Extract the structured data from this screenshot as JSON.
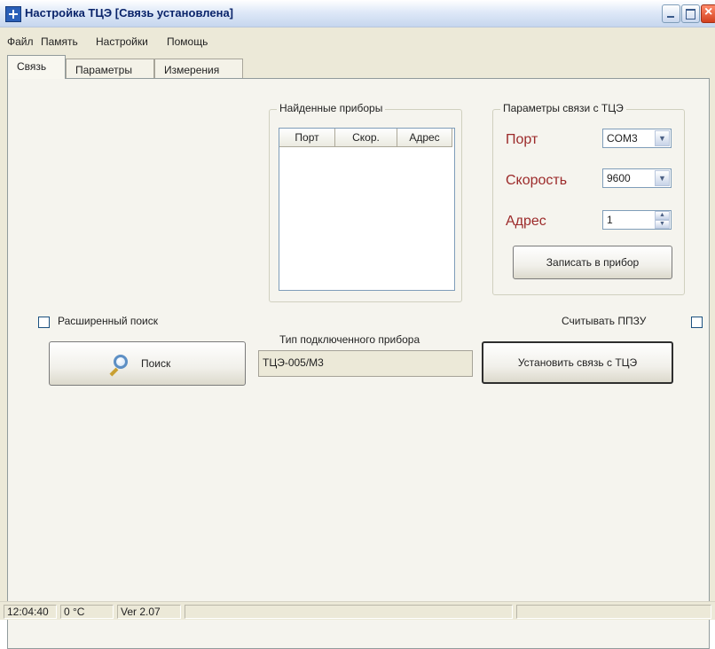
{
  "window": {
    "title": "Настройка ТЦЭ [Связь установлена]"
  },
  "menu": [
    "Файл",
    "Память",
    "Настройки",
    "Помощь"
  ],
  "tabs": [
    "Связь",
    "Параметры",
    "Измерения"
  ],
  "found_devices": {
    "title": "Найденные приборы",
    "columns": [
      "Порт",
      "Скор.",
      "Адрес"
    ]
  },
  "connection": {
    "title": "Параметры связи с ТЦЭ",
    "port_label": "Порт",
    "port_value": "COM3",
    "speed_label": "Скорость",
    "speed_value": "9600",
    "address_label": "Адрес",
    "address_value": "1",
    "write_button": "Записать в прибор"
  },
  "extended_search_label": "Расширенный поиск",
  "search_button": "Поиск",
  "device_type": {
    "label": "Тип подключенного прибора",
    "value": "ТЦЭ-005/М3"
  },
  "read_ppzu_label": "Считывать ППЗУ",
  "connect_button": "Установить связь с ТЦЭ",
  "status": {
    "time": "12:04:40",
    "temperature": "0 °C",
    "version": "Ver 2.07"
  }
}
